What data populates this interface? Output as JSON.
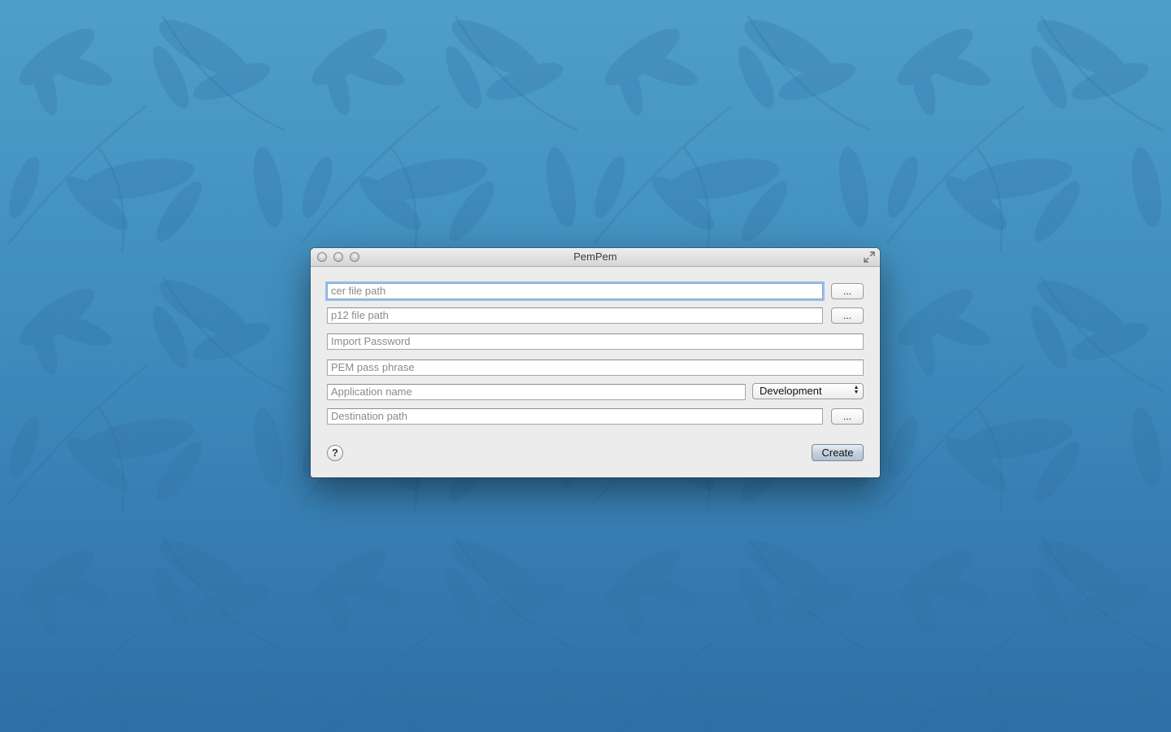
{
  "window": {
    "title": "PemPem"
  },
  "fields": {
    "cer_path": {
      "value": "",
      "placeholder": "cer file path"
    },
    "p12_path": {
      "value": "",
      "placeholder": "p12 file path"
    },
    "import_password": {
      "value": "",
      "placeholder": "Import Password"
    },
    "pem_pass_phrase": {
      "value": "",
      "placeholder": "PEM pass phrase"
    },
    "application_name": {
      "value": "",
      "placeholder": "Application name"
    },
    "destination_path": {
      "value": "",
      "placeholder": "Destination path"
    }
  },
  "buttons": {
    "browse_label": "...",
    "help_label": "?",
    "create_label": "Create"
  },
  "environment_select": {
    "selected": "Development",
    "arrows": "▲▼"
  },
  "icons": {
    "close": "close-icon",
    "minimize": "minimize-icon",
    "zoom": "zoom-icon",
    "fullscreen": "fullscreen-icon",
    "help": "question-mark-icon"
  },
  "colors": {
    "desktop_top": "#4f9fc9",
    "desktop_bottom": "#2e6fa6",
    "window_background": "#ececec",
    "focus_ring": "#9cbfe8",
    "default_button": "#c6d1de"
  }
}
